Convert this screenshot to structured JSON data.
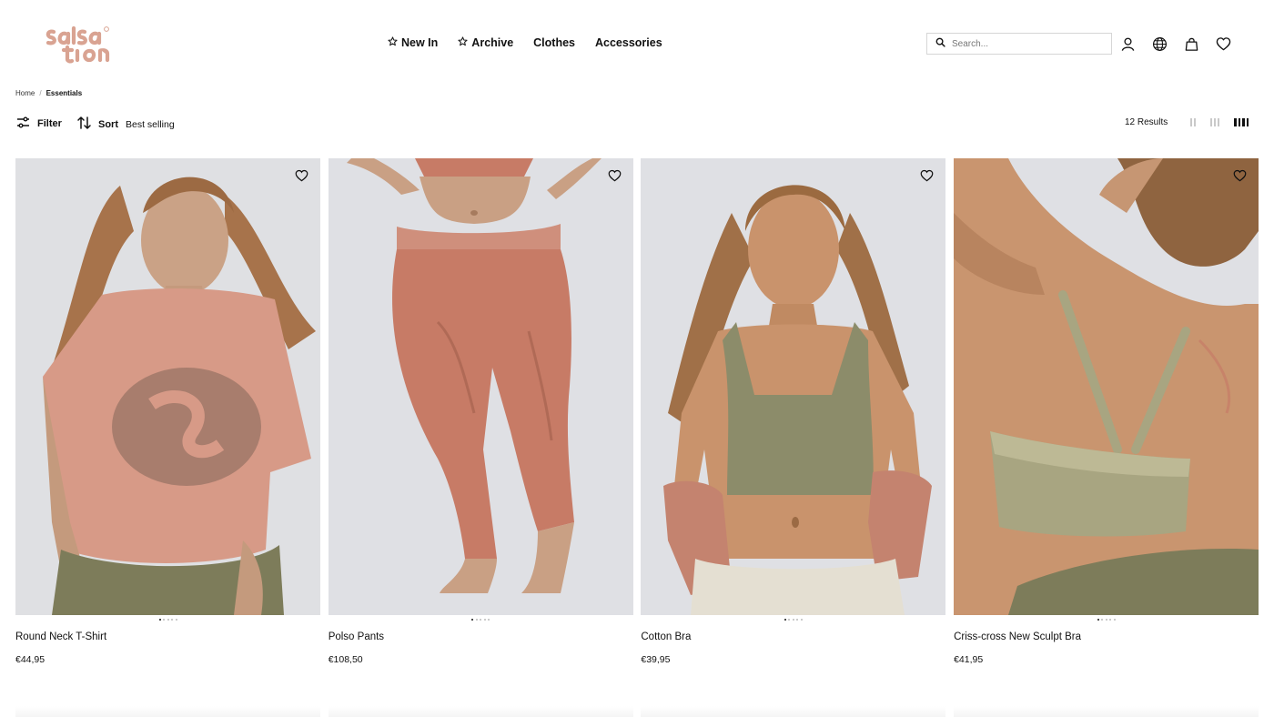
{
  "brand": {
    "logo_text": "salsa tion",
    "logo_color": "#d9a392"
  },
  "nav": {
    "items": [
      {
        "label": "New In",
        "icon": "star-icon"
      },
      {
        "label": "Archive",
        "icon": "star-icon"
      },
      {
        "label": "Clothes"
      },
      {
        "label": "Accessories"
      }
    ]
  },
  "search": {
    "placeholder": "Search..."
  },
  "header_icons": [
    "user-icon",
    "globe-icon",
    "bag-icon",
    "heart-icon"
  ],
  "breadcrumb": {
    "home": "Home",
    "current": "Essentials"
  },
  "toolbar": {
    "filter_label": "Filter",
    "sort_label": "Sort",
    "sort_value": "Best selling",
    "results": "12 Results",
    "grid_options": [
      "2-columns",
      "3-columns",
      "4-columns"
    ],
    "grid_selected": "4-columns"
  },
  "products": [
    {
      "name": "Round Neck T-Shirt",
      "price": "€44,95",
      "image_slides": 5,
      "active_slide": 1
    },
    {
      "name": "Polso Pants",
      "price": "€108,50",
      "image_slides": 5,
      "active_slide": 1
    },
    {
      "name": "Cotton Bra",
      "price": "€39,95",
      "image_slides": 5,
      "active_slide": 1
    },
    {
      "name": "Criss-cross New Sculpt Bra",
      "price": "€41,95",
      "image_slides": 5,
      "active_slide": 1
    }
  ],
  "colors": {
    "tshirt": "#d79a87",
    "pants": "#c77b66",
    "bra": "#8c8c6a",
    "sculpt": "#a8a581",
    "background": "#e0e1e4"
  }
}
